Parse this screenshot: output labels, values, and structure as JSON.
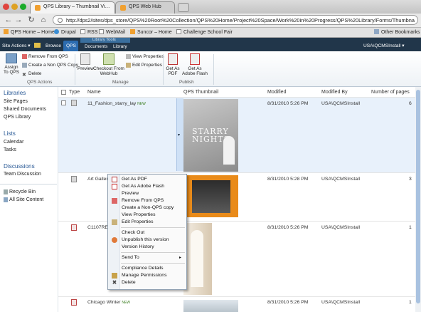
{
  "browser": {
    "tabs": [
      {
        "title": "QPS Library – Thumbnail Vi…",
        "active": true
      },
      {
        "title": "QPS Web Hub",
        "active": false
      }
    ],
    "url": "http://dps2/sites/dps_store/QPS%20Root%20Collection/QPS%20Home/Project%20Space/Work%20in%20Progress/QPS%20Library/Forms/Thumbna",
    "bookmarks": [
      "QPS Home – Home",
      "Drupal",
      "RSS",
      "WebMail",
      "Suncor – Home",
      "Challenge School Fair"
    ],
    "other_bookmarks": "Other Bookmarks"
  },
  "ribbon": {
    "site_actions": "Site Actions",
    "tabs": [
      "Browse",
      "QPS",
      "Documents",
      "Library"
    ],
    "active_tab": "QPS",
    "tools_label": "Library Tools",
    "user": "USA\\QCMSInstall",
    "buttons": {
      "assign_to_qps": "Assign To QPS",
      "remove_from_qps": "Remove From QPS",
      "create_non_qps_copy": "Create a Non QPS Copy",
      "delete": "Delete",
      "preview": "Preview",
      "checkout_from_webhub": "Checkout From WebHub",
      "view_properties": "View Properties",
      "edit_properties": "Edit Properties",
      "get_as_pdf": "Get As PDF",
      "get_as_adobe_flash": "Get As Adobe Flash"
    },
    "groups": [
      "QPS Actions",
      "Manage",
      "Publish"
    ]
  },
  "quicklaunch": {
    "libraries_heading": "Libraries",
    "libraries": [
      "Site Pages",
      "Shared Documents",
      "QPS Library"
    ],
    "lists_heading": "Lists",
    "lists": [
      "Calendar",
      "Tasks"
    ],
    "discussions_heading": "Discussions",
    "discussions": [
      "Team Discussion"
    ],
    "recycle_bin": "Recycle Bin",
    "all_site_content": "All Site Content"
  },
  "table": {
    "headers": [
      "Type",
      "Name",
      "QPS Thumbnail",
      "Modified",
      "Modified By",
      "Number of pages"
    ],
    "new_badge": "NEW",
    "rows": [
      {
        "name": "11_Fashion_starry_lay",
        "modified": "8/31/2010 5:26 PM",
        "modified_by": "USA\\QCMSInstall",
        "pages": "6",
        "is_new": true
      },
      {
        "name": "Art Gallery",
        "modified": "8/31/2010 5:28 PM",
        "modified_by": "USA\\QCMSInstall",
        "pages": "3",
        "is_new": false
      },
      {
        "name": "C1107REZ",
        "modified": "8/31/2010 5:26 PM",
        "modified_by": "USA\\QCMSInstall",
        "pages": "1",
        "is_new": false
      },
      {
        "name": "Chicago Winter",
        "modified": "8/31/2010 5:26 PM",
        "modified_by": "USA\\QCMSInstall",
        "pages": "1",
        "is_new": true
      }
    ],
    "thumbnail_text": "STARRY NIGHTS"
  },
  "context_menu": {
    "items": [
      {
        "label": "Get As PDF",
        "icon": "pdf-icon"
      },
      {
        "label": "Get As Adobe Flash",
        "icon": "flash-icon"
      },
      {
        "label": "Preview",
        "icon": "none"
      },
      {
        "label": "Remove From QPS",
        "icon": "remove-icon"
      },
      {
        "label": "Create a Non-QPS copy",
        "icon": "none"
      },
      {
        "label": "View Properties",
        "icon": "none"
      },
      {
        "label": "Edit Properties",
        "icon": "edit-icon"
      },
      {
        "label": "Check Out",
        "icon": "none"
      },
      {
        "label": "Unpublish this version",
        "icon": "unpublish-icon"
      },
      {
        "label": "Version History",
        "icon": "none"
      },
      {
        "label": "Send To",
        "icon": "none"
      },
      {
        "label": "Compliance Details",
        "icon": "none"
      },
      {
        "label": "Manage Permissions",
        "icon": "permissions-icon"
      },
      {
        "label": "Delete",
        "icon": "delete-icon"
      }
    ]
  },
  "colors": {
    "ribbon_dark": "#21364a",
    "ribbon_tab_active": "#2c6cb0",
    "link": "#2a5a96",
    "menu_border": "#8f9fb0"
  }
}
